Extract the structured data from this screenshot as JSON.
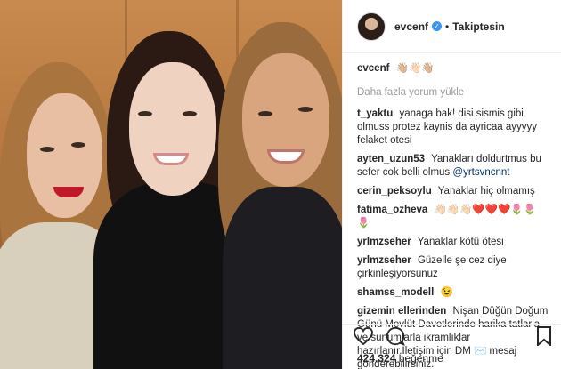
{
  "post": {
    "username": "evcenf",
    "follow_status": "Takiptesin",
    "caption_user": "evcenf",
    "caption_text": "👋🏼👋🏻👋🏼",
    "load_more": "Daha fazla yorum yükle",
    "likes_count": "424.324",
    "likes_label": "beğenme"
  },
  "comments": [
    {
      "user": "t_yaktu",
      "text": "yanaga bak! disi sismis gibi olmuss protez kaynis da ayricaa ayyyyy felaket otesi"
    },
    {
      "user": "ayten_uzun53",
      "text": "Yanakları doldurtmus bu sefer cok belli olmus",
      "mention": "@yrtsvncnnt"
    },
    {
      "user": "cerin_peksoylu",
      "text": "Yanaklar hiç olmamış"
    },
    {
      "user": "fatima_ozheva",
      "text": "👋🏻👋🏻👋🏻❤️❤️❤️🌷🌷🌷"
    },
    {
      "user": "yrlmzseher",
      "text": "Yanaklar kötü ötesi"
    },
    {
      "user": "yrlmzseher",
      "text": "Güzelle şe cez diye çirkinleşiyorsunuz"
    },
    {
      "user": "shamss_modell",
      "text": "😉"
    },
    {
      "user": "gizemin ellerinden",
      "text": "Nişan Düğün Doğum Günü Mevlüt Davetlerinde harika tatlarla ve sunumlarla ikramlıklar hazırlanır.İletişim için DM ✉️ mesaj gönderebilirsiniz."
    }
  ],
  "icons": {
    "verified": "verified-badge-icon",
    "heart": "heart-icon",
    "comment": "comment-icon",
    "save": "bookmark-icon"
  },
  "colors": {
    "verified_blue": "#3897f0",
    "muted_text": "#999999",
    "border": "#efefef"
  }
}
